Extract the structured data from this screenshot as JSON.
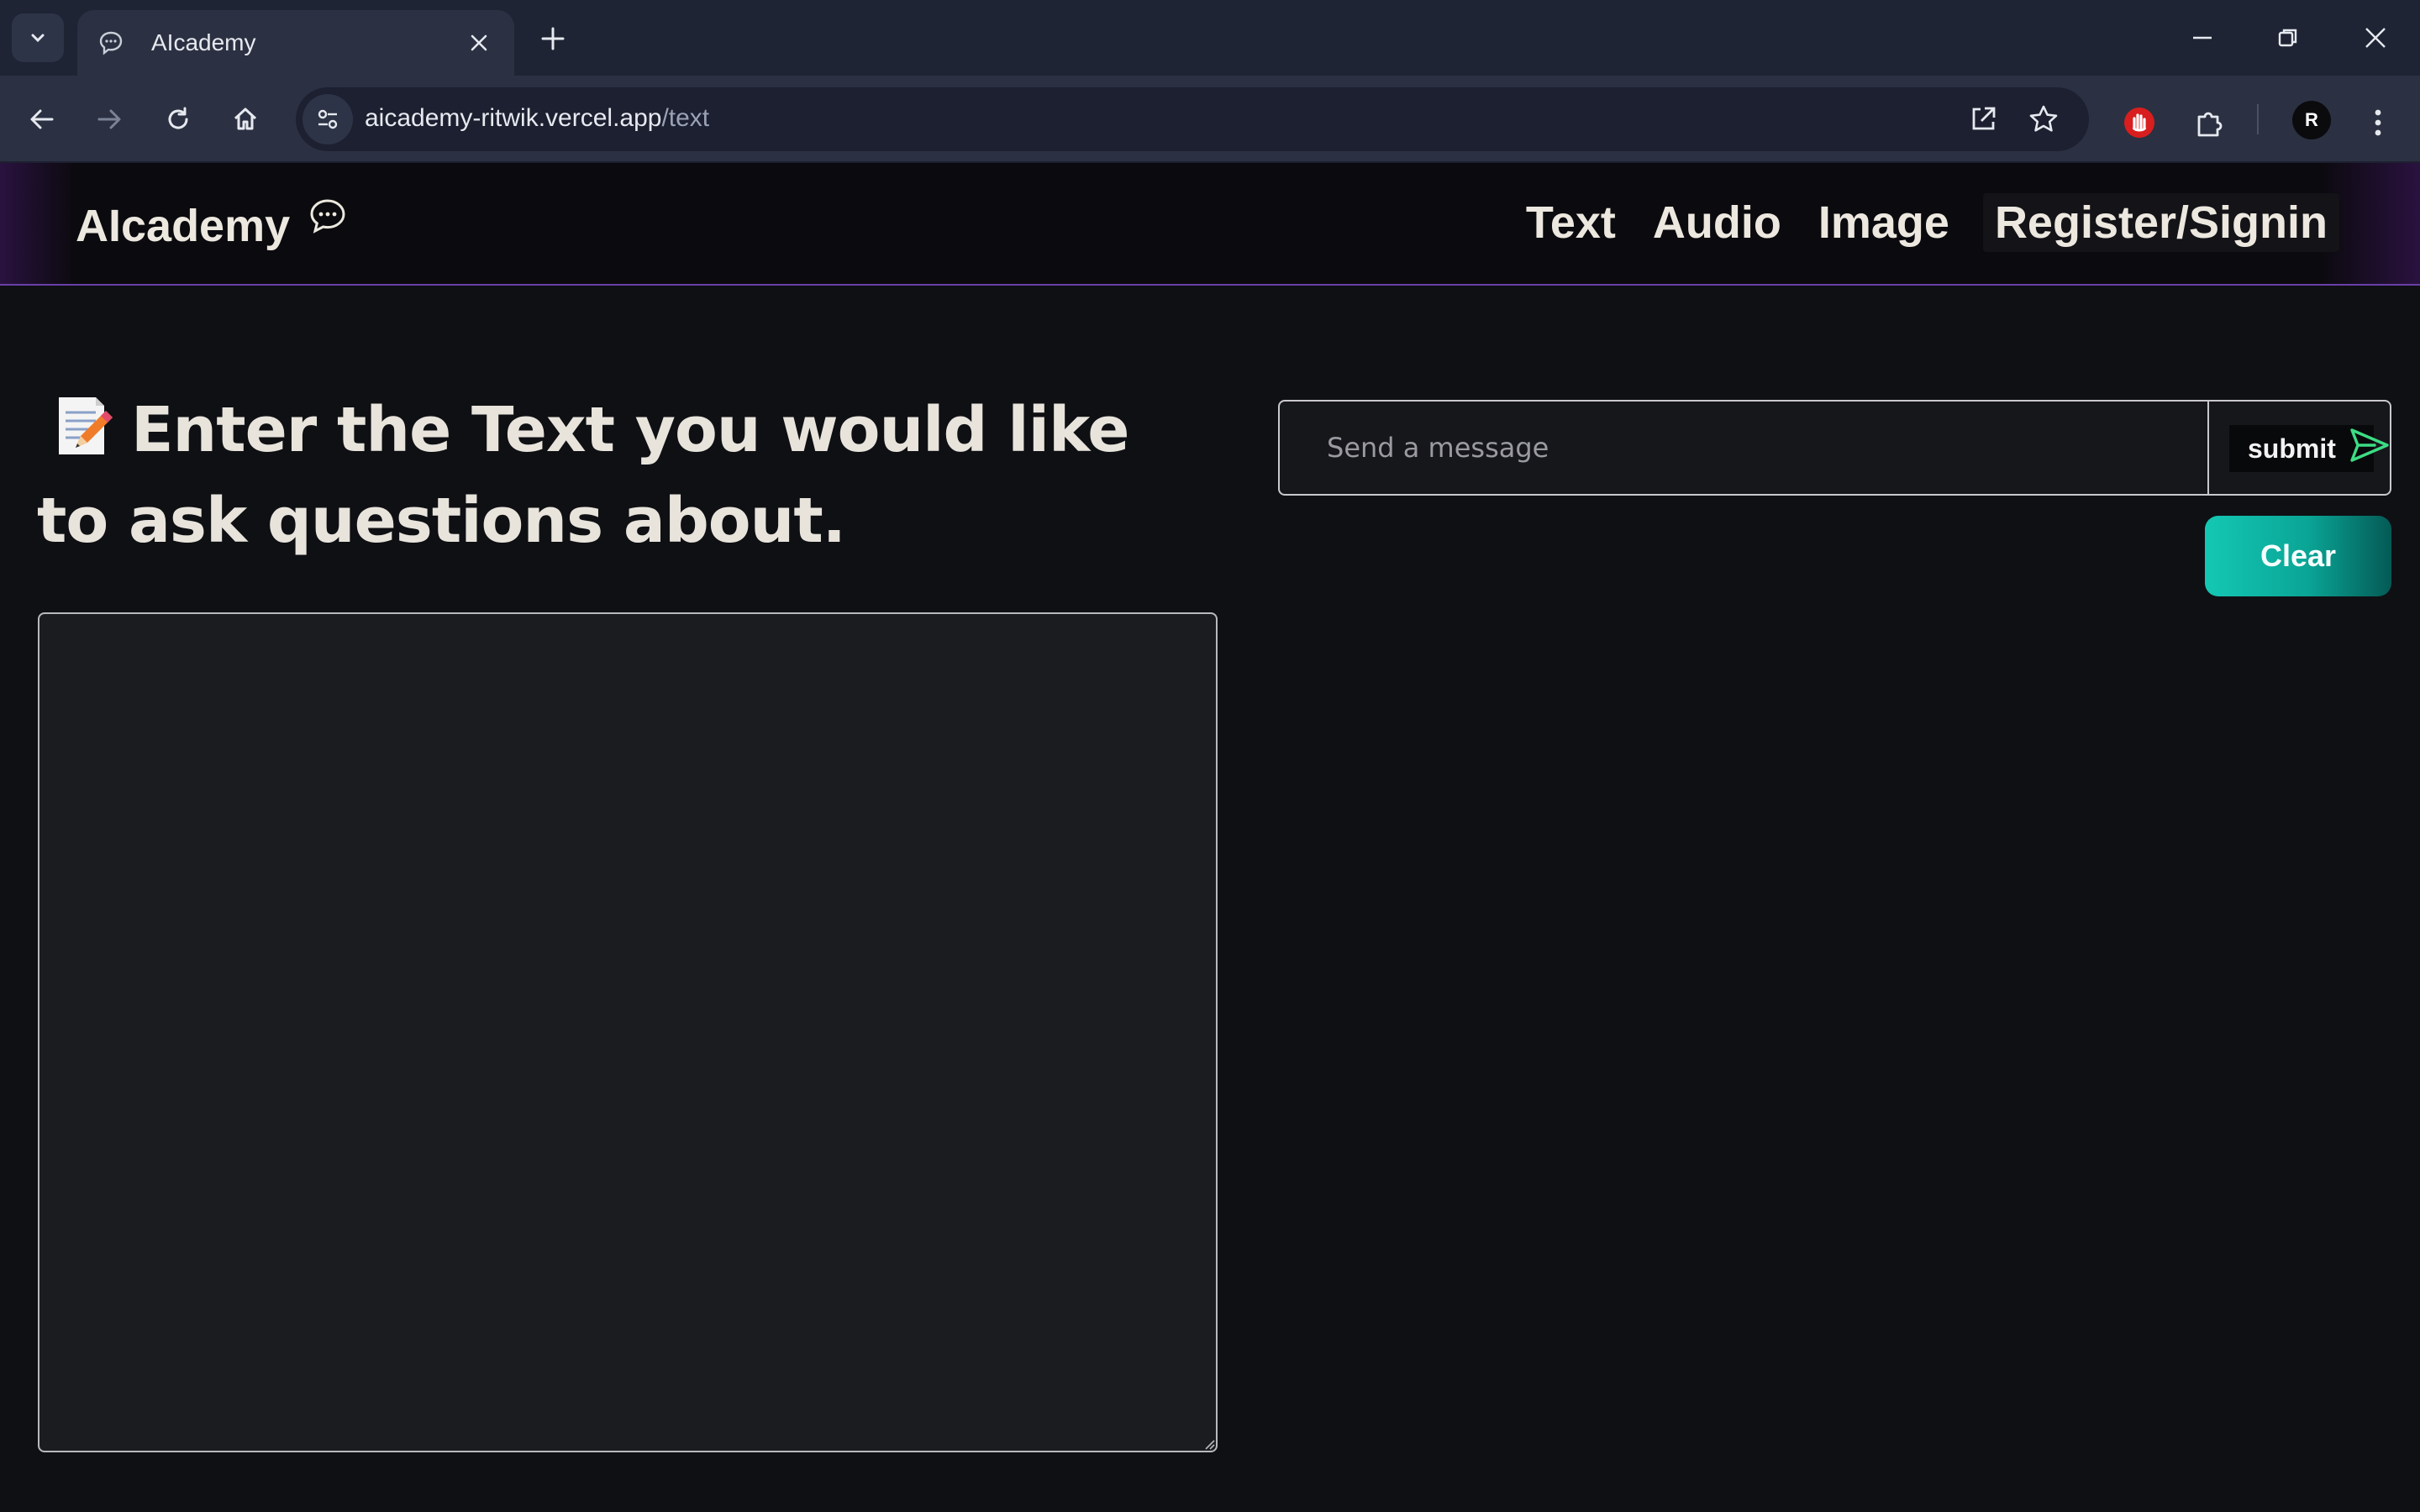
{
  "browser": {
    "tab_title": "AIcademy",
    "url_host": "aicademy-ritwik.vercel.app",
    "url_path": "/text",
    "avatar_letter": "R"
  },
  "site": {
    "brand": "AIcademy",
    "nav": [
      {
        "label": "Text"
      },
      {
        "label": "Audio"
      },
      {
        "label": "Image"
      },
      {
        "label": "Register/Signin"
      }
    ]
  },
  "main": {
    "heading": "Enter the Text you would like to ask questions about.",
    "heading_icon": "memo-icon",
    "textarea_value": "",
    "message_placeholder": "Send a message",
    "submit_label": "submit",
    "clear_label": "Clear"
  },
  "colors": {
    "accent_teal": "#14c8b4",
    "send_icon_green": "#3ddc84",
    "navbar_border": "#6a3fa8"
  }
}
